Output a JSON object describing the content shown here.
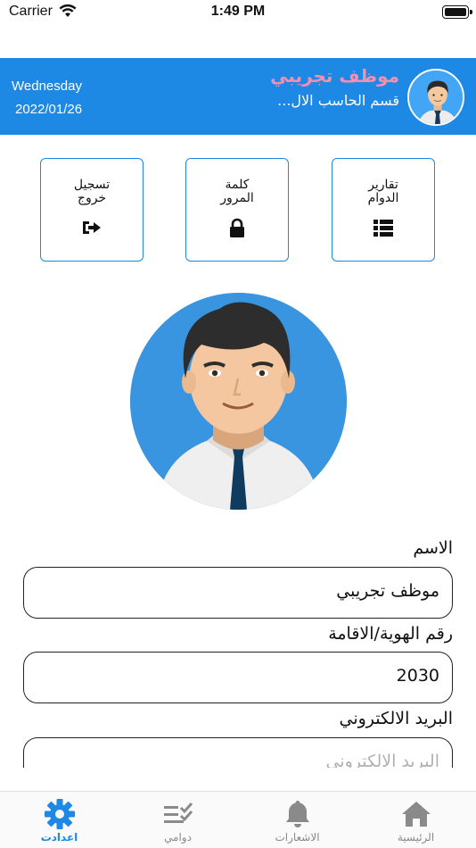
{
  "status_bar": {
    "carrier": "Carrier",
    "time": "1:49 PM"
  },
  "header": {
    "day": "Wednesday",
    "date": "2022/01/26",
    "employee_name": "موظف تجريبي",
    "department": "قسم الحاسب الال..."
  },
  "actions": {
    "logout": {
      "label": "تسجيل\nخروج",
      "icon": "sign-out-icon"
    },
    "password": {
      "label": "كلمة\nالمرور",
      "icon": "lock-icon"
    },
    "reports": {
      "label": "تقارير\nالدوام",
      "icon": "list-icon"
    }
  },
  "form": {
    "name_label": "الاسم",
    "name_value": "موظف تجريبي",
    "id_label": "رقم الهوية/الاقامة",
    "id_value": "2030",
    "email_label": "البريد الالكتروني",
    "email_placeholder": "البريد الالكتروني"
  },
  "tabs": [
    {
      "label": "اعدادت",
      "icon": "gear-icon",
      "active": true
    },
    {
      "label": "دوامي",
      "icon": "checklist-icon",
      "active": false
    },
    {
      "label": "الاشعارات",
      "icon": "bell-icon",
      "active": false
    },
    {
      "label": "الرئيسية",
      "icon": "home-icon",
      "active": false
    }
  ],
  "colors": {
    "primary": "#1e88e5",
    "accent_name": "#f48fb1",
    "tab_inactive": "#8a8a8a"
  }
}
